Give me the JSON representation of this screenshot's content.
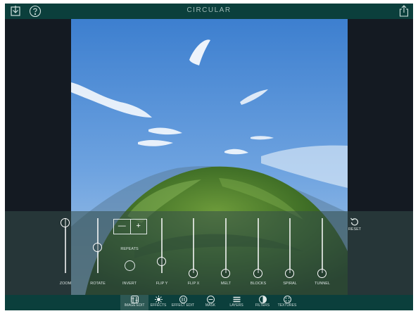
{
  "app": {
    "title": "CIRCULAR"
  },
  "colors": {
    "bar": "#0b3f3c",
    "active_tab": "#2d5854",
    "side_panels": "#141a22"
  },
  "topbar": {
    "icons": [
      "download-icon",
      "help-icon",
      "share-icon"
    ]
  },
  "controls": {
    "repeats": {
      "label": "REPEATS",
      "minus": "—",
      "plus": "+"
    },
    "sliders": [
      {
        "id": "zoom",
        "label": "ZOOM",
        "value": 0.92
      },
      {
        "id": "rotate",
        "label": "ROTATE",
        "value": 0.48
      },
      {
        "id": "flip-y",
        "label": "FLIP Y",
        "value": 0.22
      },
      {
        "id": "flip-x",
        "label": "FLIP X",
        "value": 0.0
      },
      {
        "id": "melt",
        "label": "MELT",
        "value": 0.0
      },
      {
        "id": "blocks",
        "label": "BLOCKS",
        "value": 0.0
      },
      {
        "id": "spiral",
        "label": "SPIRAL",
        "value": 0.0
      },
      {
        "id": "tunnel",
        "label": "TUNNEL",
        "value": 0.0
      }
    ],
    "invert": {
      "label": "INVERT"
    },
    "reset": {
      "label": "RESET"
    }
  },
  "tabs": [
    {
      "label": "IMAGE EDIT",
      "icon": "sliders-icon",
      "active": true
    },
    {
      "label": "EFFECTS",
      "icon": "sparkle-icon",
      "active": false
    },
    {
      "label": "EFFECT EDIT",
      "icon": "effect-sliders-icon",
      "active": false
    },
    {
      "label": "MASK",
      "icon": "mask-icon",
      "active": false
    },
    {
      "label": "LAYERS",
      "icon": "layers-icon",
      "active": false
    },
    {
      "label": "FILTERS",
      "icon": "filters-icon",
      "active": false
    },
    {
      "label": "TEXTURES",
      "icon": "textures-icon",
      "active": false
    }
  ]
}
